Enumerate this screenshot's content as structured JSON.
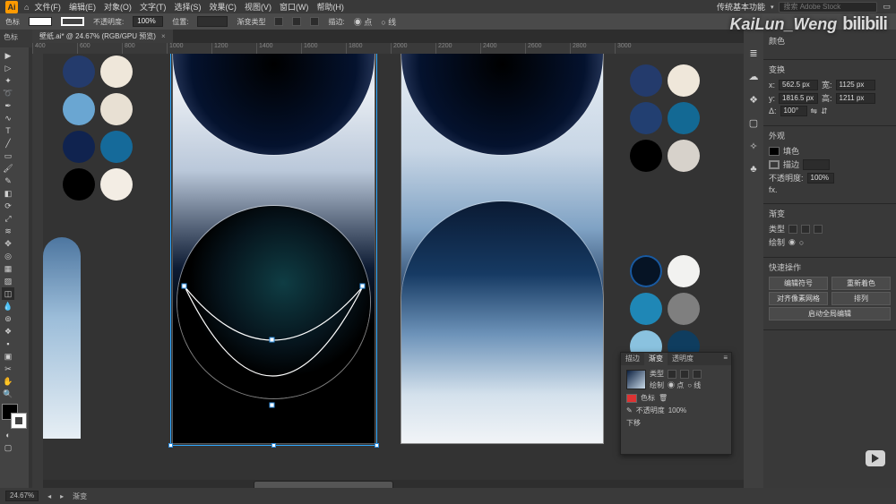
{
  "watermark": {
    "author": "KaiLun_Weng",
    "site": "bilibili"
  },
  "menubar": {
    "items": [
      "文件(F)",
      "编辑(E)",
      "对象(O)",
      "文字(T)",
      "选择(S)",
      "效果(C)",
      "视图(V)",
      "窗口(W)",
      "帮助(H)"
    ],
    "workspace": "传统基本功能",
    "search_placeholder": "搜索 Adobe Stock"
  },
  "optbar": {
    "label_left": "色标",
    "opacity_label": "不透明度:",
    "opacity_value": "100%",
    "loc_label": "位置:",
    "grad_type_label": "渐变类型",
    "stroke_label": "描边:",
    "radio_a": "点",
    "radio_b": "线"
  },
  "document": {
    "tab_title": "壁纸.ai* @ 24.67% (RGB/GPU 预览)",
    "zoom": "24.67%"
  },
  "ruler_marks": [
    "400",
    "600",
    "800",
    "1000",
    "1200",
    "1400",
    "1600",
    "1800",
    "2000",
    "2200",
    "2400",
    "2600",
    "2800",
    "3000"
  ],
  "swatch_groups": {
    "g1": [
      "#243b6c",
      "#efe7da",
      "#6aa6d2",
      "#e8e0d3",
      "#10234f",
      "#156a9a",
      "#000000",
      "#f3ede4"
    ],
    "g2": [
      "#243b6c",
      "#efe7da",
      "#223f71",
      "#136994",
      "#000000",
      "#d7d2cb"
    ],
    "g3": [
      "#061425",
      "#f2f2f0",
      "#1f87b6",
      "#7f7f7f",
      "#8ac2df",
      "#0f3d5f"
    ]
  },
  "transform_panel": {
    "title": "变换",
    "x_label": "x:",
    "x_value": "562.5 px",
    "w_label": "宽:",
    "w_value": "1125 px",
    "y_label": "y:",
    "y_value": "1816.5 px",
    "h_label": "高:",
    "h_value": "1211 px",
    "angle_label": "Δ:",
    "angle_value": "100°"
  },
  "appearance_panel": {
    "title": "外观",
    "fill_label": "填色",
    "stroke_label": "描边",
    "opacity_label": "不透明度:",
    "opacity_value": "100%",
    "fx_label": "fx."
  },
  "gradient_panel": {
    "title": "渐变",
    "type_label": "类型",
    "edit_label": "绘制"
  },
  "quick_actions": {
    "title": "快速操作",
    "btn1": "编辑符号",
    "btn2": "重新着色",
    "btn3": "对齐像素网格",
    "btn4": "排列",
    "btn5": "启动全局编辑"
  },
  "float_gradient": {
    "tab1": "描边",
    "tab2": "渐变",
    "tab3": "透明度",
    "type_label": "类型",
    "edit_label": "绘制",
    "color_label": "色标",
    "radio_a": "点",
    "radio_b": "线",
    "opacity_label": "不透明度",
    "opacity_value": "100%",
    "loc_label": "下移"
  },
  "statusbar": {
    "layer_label": "渐变"
  },
  "leftstrip_label": "色标",
  "colors": {
    "accent": "#2fa8ff"
  }
}
